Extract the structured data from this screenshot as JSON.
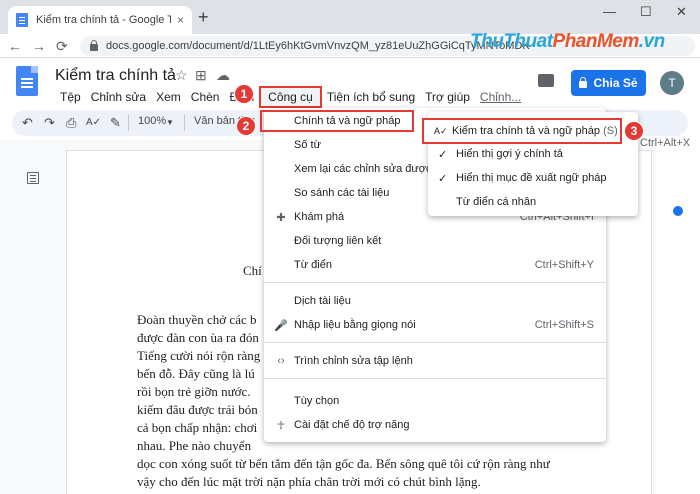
{
  "browser": {
    "tab_title": "Kiểm tra chính tả - Google Tài liệu",
    "tab_close": "×",
    "new_tab": "+",
    "win_min": "—",
    "win_max": "☐",
    "win_close": "✕",
    "back": "←",
    "forward": "→",
    "reload": "⟳",
    "url": "docs.google.com/document/d/1LtEy6hKtGvmVnvzQM_yz81eUuZhGGiCqTyMNToMDK"
  },
  "watermark": {
    "text_a": "ThuThuat",
    "text_b": "PhanMem",
    "text_c": ".vn"
  },
  "docs": {
    "title": "Kiểm tra chính tả",
    "star": "☆",
    "move": "⊞",
    "cloud": "☁",
    "menus": [
      "Tệp",
      "Chỉnh sửa",
      "Xem",
      "Chèn",
      "Định",
      "Công cụ",
      "Tiện ích bổ sung",
      "Trợ giúp",
      "Chỉnh..."
    ],
    "share_label": "Chia Sẻ",
    "avatar_letter": "T"
  },
  "toolbar": {
    "undo": "↶",
    "redo": "↷",
    "print": "⎙",
    "spell": "A✓",
    "paint": "✎",
    "zoom": "100%",
    "style": "Văn bản thư"
  },
  "document": {
    "heading": "Chí",
    "lines": [
      "Đoàn thuyền chở các b",
      "được đàn con ùa ra đón",
      "Tiếng cười nói rộn ràng",
      "bến đỗ. Đây cũng là lú",
      "rồi bọn trẻ giỡn nước.",
      "kiếm đâu được trái bón",
      "cả bọn chấp nhận: chơi",
      "nhau. Phe nào chuyển",
      "dọc con xóng suốt từ bến tắm đến tận gốc đa. Bến sông quê tôi cứ rộn ràng như",
      "vậy cho đến lúc mặt trời nặn phía chân trời mới có chút bình lặng."
    ]
  },
  "tools_menu": {
    "items": [
      {
        "label": "Chính tả và ngữ pháp",
        "shortcut": "",
        "icon": "",
        "arrow": "▸"
      },
      {
        "label": "Số từ",
        "shortcut": "",
        "icon": ""
      },
      {
        "label": "Xem lại các chỉnh sửa được",
        "shortcut": "",
        "icon": ""
      },
      {
        "label": "So sánh các tài liệu",
        "shortcut": "",
        "icon": ""
      },
      {
        "label": "Khám phá",
        "shortcut": "Ctrl+Alt+Shift+I",
        "icon": "✚"
      },
      {
        "label": "Đối tượng liên kết",
        "shortcut": "",
        "icon": ""
      },
      {
        "label": "Từ điển",
        "shortcut": "Ctrl+Shift+Y",
        "icon": ""
      },
      {
        "label": "Dịch tài liệu",
        "shortcut": "",
        "icon": ""
      },
      {
        "label": "Nhập liệu bằng giọng nói",
        "shortcut": "Ctrl+Shift+S",
        "icon": "🎤"
      },
      {
        "label": "Trình chỉnh sửa tập lệnh",
        "shortcut": "",
        "icon": "‹›"
      },
      {
        "label": "Tùy chọn",
        "shortcut": "",
        "icon": ""
      },
      {
        "label": "Cài đặt chế độ trợ năng",
        "shortcut": "",
        "icon": "☥"
      }
    ]
  },
  "submenu": {
    "check_label": "Kiểm tra chính tả và ngữ pháp",
    "check_hint": "(S)",
    "check_shortcut": "Ctrl+Alt+X",
    "suggest_label": "Hiển thị gợi ý chính tả",
    "grammar_label": "Hiển thị mục đề xuất ngữ pháp",
    "dictionary_label": "Từ điển cá nhân",
    "checkmark": "✓",
    "spell_icon": "A✓"
  },
  "badges": [
    "1",
    "2",
    "3"
  ],
  "colors": {
    "accent": "#1a73e8",
    "highlight_box": "#e53935"
  }
}
